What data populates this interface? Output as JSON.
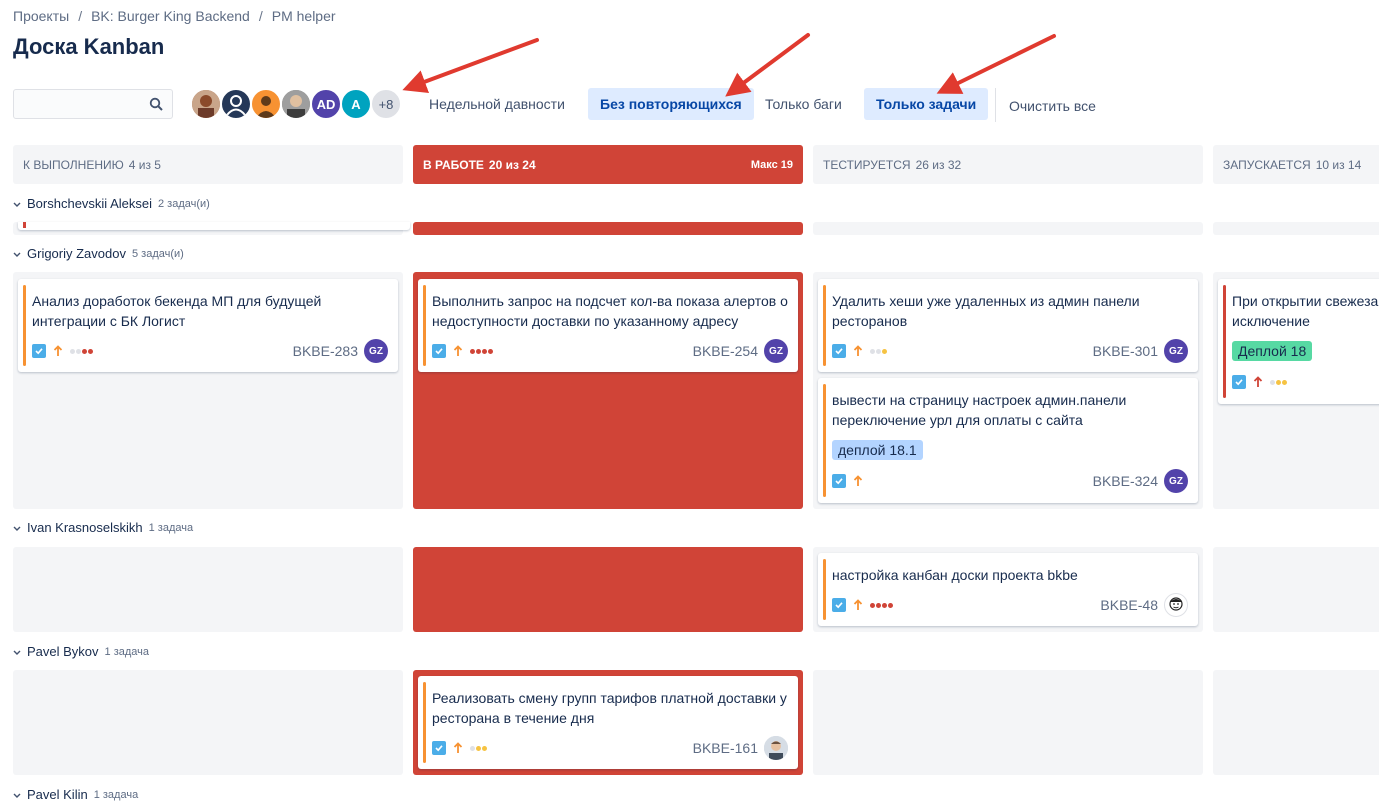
{
  "breadcrumb": [
    "Проекты",
    "BK: Burger King Backend",
    "PM helper"
  ],
  "page_title": "Доска Kanban",
  "search": {
    "placeholder": "",
    "value": ""
  },
  "avatars": [
    {
      "name": "user-photo-1",
      "initials": "",
      "color": "#a0522d"
    },
    {
      "name": "user-default",
      "initials": "",
      "color": "#253858"
    },
    {
      "name": "user-orange",
      "initials": "",
      "color": "#f79232"
    },
    {
      "name": "user-photo-2",
      "initials": "",
      "color": "#7a7a7a"
    },
    {
      "name": "AD",
      "initials": "AD",
      "color": "#5243aa"
    },
    {
      "name": "A",
      "initials": "A",
      "color": "#00a3bf"
    },
    {
      "name": "more",
      "initials": "+8",
      "color": "#dfe1e6"
    }
  ],
  "filters": [
    {
      "label": "Недельной давности",
      "active": false
    },
    {
      "label": "Без повторяющихся",
      "active": true
    },
    {
      "label": "Только баги",
      "active": false
    },
    {
      "label": "Только задачи",
      "active": true
    },
    {
      "label": "Очистить все",
      "active": false
    }
  ],
  "columns": [
    {
      "title": "К выполнению",
      "count": "4 из 5",
      "max": "",
      "over": false
    },
    {
      "title": "В работе",
      "count": "20 из 24",
      "max": "Макс 19",
      "over": true
    },
    {
      "title": "Тестируется",
      "count": "26 из 32",
      "max": "",
      "over": false
    },
    {
      "title": "Запускается",
      "count": "10 из 14",
      "max": "",
      "over": false
    }
  ],
  "swimlanes": [
    {
      "name": "Borshchevskii Aleksei",
      "count": "2 задач(и)"
    },
    {
      "name": "Grigoriy Zavodov",
      "count": "5 задач(и)"
    },
    {
      "name": "Ivan Krasnoselskikh",
      "count": "1 задача"
    },
    {
      "name": "Pavel Bykov",
      "count": "1 задача"
    },
    {
      "name": "Pavel Kilin",
      "count": "1 задача"
    }
  ],
  "cards": [
    {
      "summary": "Анализ доработок бекенда МП для будущей интеграции с БК Логист",
      "key": "BKBE-283",
      "assignee": "GZ",
      "label": ""
    },
    {
      "summary": "Выполнить запрос на подсчет кол-ва показа алертов о недоступности доставки по указанному адресу",
      "key": "BKBE-254",
      "assignee": "GZ",
      "label": ""
    },
    {
      "summary": "Удалить хеши уже удаленных из админ панели ресторанов",
      "key": "BKBE-301",
      "assignee": "GZ",
      "label": ""
    },
    {
      "summary": "вывести на страницу настроек админ.панели переключение урл для оплаты с сайта",
      "key": "BKBE-324",
      "assignee": "GZ",
      "label": "деплой 18.1"
    },
    {
      "summary": "При открытии свежезаказа исключение",
      "key": "",
      "assignee": "",
      "label": "Деплой 18"
    },
    {
      "summary": "настройка канбан доски проекта bkbe",
      "key": "BKBE-48",
      "assignee": "",
      "label": ""
    },
    {
      "summary": "Реализовать смену групп тарифов платной доставки у ресторана в течение дня",
      "key": "BKBE-161",
      "assignee": "",
      "label": ""
    }
  ],
  "colors": {
    "accent": "#0052cc",
    "over_limit": "#d04437",
    "priority_high": "#f79232",
    "priority_highest": "#d04437"
  }
}
